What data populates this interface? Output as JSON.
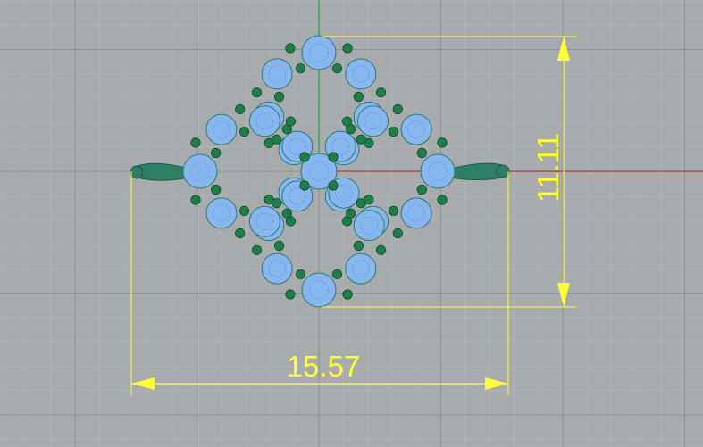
{
  "viewport": {
    "background": "#a8abae",
    "grid_minor_color": "#b2b5b8",
    "grid_major_color": "#8e9194",
    "x_axis_color": "#a83a34",
    "y_axis_color": "#2e9a45"
  },
  "model": {
    "stone_fill": "#88b6ee",
    "stone_stroke": "#2a7a70",
    "bead_color": "#1e7e4a",
    "shank_color": "#2f7f66"
  },
  "dimensions": {
    "color": "#ffff33",
    "width_label": "15.57",
    "height_label": "11.11"
  }
}
